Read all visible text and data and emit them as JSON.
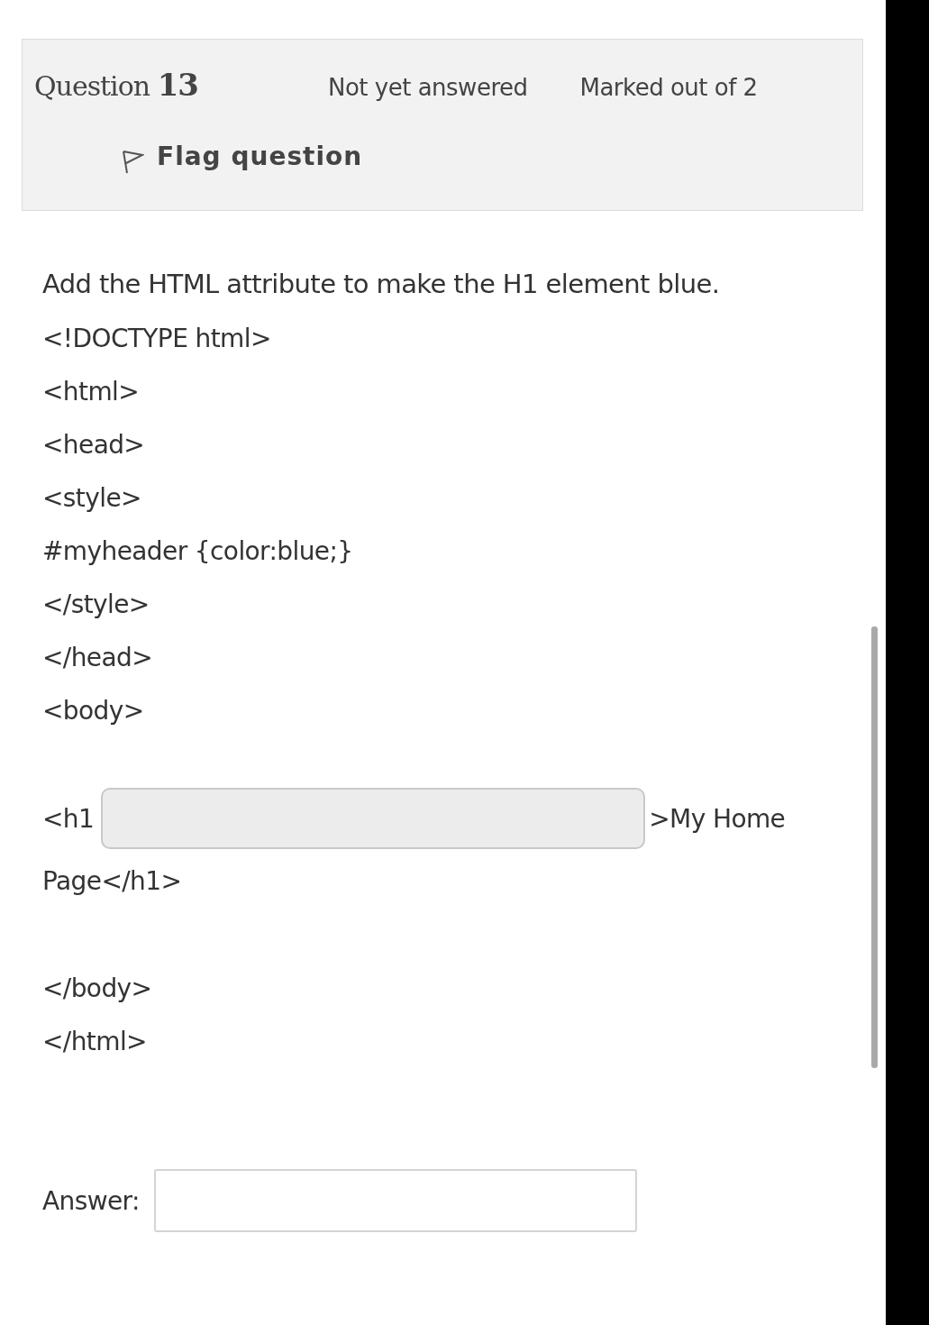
{
  "question": {
    "title": "Question",
    "number": "13",
    "status": "Not yet answered",
    "marks": "Marked out of 2",
    "flag": {
      "label": "Flag question",
      "flagged": false
    }
  },
  "prompt": "Add the HTML attribute to make the H1 element blue.",
  "code_lines": [
    "<!DOCTYPE html>",
    "<html>",
    "<head>",
    "<style>",
    "#myheader {color:blue;}",
    "</style>",
    "</head>",
    "<body>"
  ],
  "blank_line": {
    "before": "<h1",
    "after": ">My Home",
    "continued": "Page</h1>"
  },
  "closing_lines": [
    "</body>",
    "</html>"
  ],
  "answer": {
    "label": "Answer:"
  }
}
